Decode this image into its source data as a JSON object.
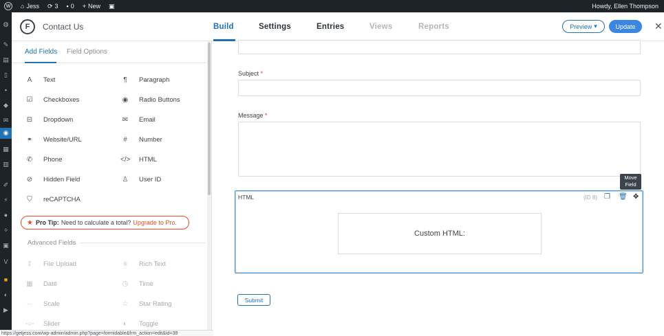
{
  "adminbar": {
    "site": "Jess",
    "updates": "3",
    "comments": "0",
    "new": "New",
    "howdy": "Howdy, Ellen Thompson"
  },
  "header": {
    "form_title": "Contact Us",
    "tabs": [
      "Build",
      "Settings",
      "Entries",
      "Views",
      "Reports"
    ],
    "active_tab": "Build",
    "preview": "Preview",
    "update": "Update",
    "close": "✕"
  },
  "panel": {
    "tabs": [
      "Add Fields",
      "Field Options"
    ],
    "fields_left": [
      {
        "label": "Text",
        "icon": "text-icon"
      },
      {
        "label": "Checkboxes",
        "icon": "checkbox-icon"
      },
      {
        "label": "Dropdown",
        "icon": "dropdown-icon"
      },
      {
        "label": "Website/URL",
        "icon": "link-icon"
      },
      {
        "label": "Phone",
        "icon": "phone-icon"
      },
      {
        "label": "Hidden Field",
        "icon": "eye-slash-icon"
      },
      {
        "label": "reCAPTCHA",
        "icon": "shield-icon"
      }
    ],
    "fields_right": [
      {
        "label": "Paragraph",
        "icon": "paragraph-icon"
      },
      {
        "label": "Radio Buttons",
        "icon": "radio-icon"
      },
      {
        "label": "Email",
        "icon": "envelope-icon"
      },
      {
        "label": "Number",
        "icon": "hash-icon"
      },
      {
        "label": "HTML",
        "icon": "code-icon"
      },
      {
        "label": "User ID",
        "icon": "user-icon"
      }
    ],
    "protip": {
      "label": "Pro Tip:",
      "text": "Need to calculate a total?",
      "link": "Upgrade to Pro."
    },
    "advanced_title": "Advanced Fields",
    "advanced_left": [
      {
        "label": "File Upload",
        "icon": "upload-icon"
      },
      {
        "label": "Date",
        "icon": "calendar-icon"
      },
      {
        "label": "Scale",
        "icon": "scale-icon"
      },
      {
        "label": "Slider",
        "icon": "slider-icon"
      }
    ],
    "advanced_right": [
      {
        "label": "Rich Text",
        "icon": "richtext-icon"
      },
      {
        "label": "Time",
        "icon": "clock-icon"
      },
      {
        "label": "Star Rating",
        "icon": "star-icon"
      },
      {
        "label": "Toggle",
        "icon": "toggle-icon"
      }
    ]
  },
  "canvas": {
    "subject_label": "Subject",
    "message_label": "Message",
    "required_mark": "*",
    "html_field": {
      "label": "HTML",
      "id": "(ID 8)",
      "content": "Custom HTML:",
      "tooltip": "Move Field"
    },
    "submit": "Submit"
  },
  "statusbar": "https://getjess.com/wp-admin/admin.php?page=formidable&frm_action=edit&id=38"
}
